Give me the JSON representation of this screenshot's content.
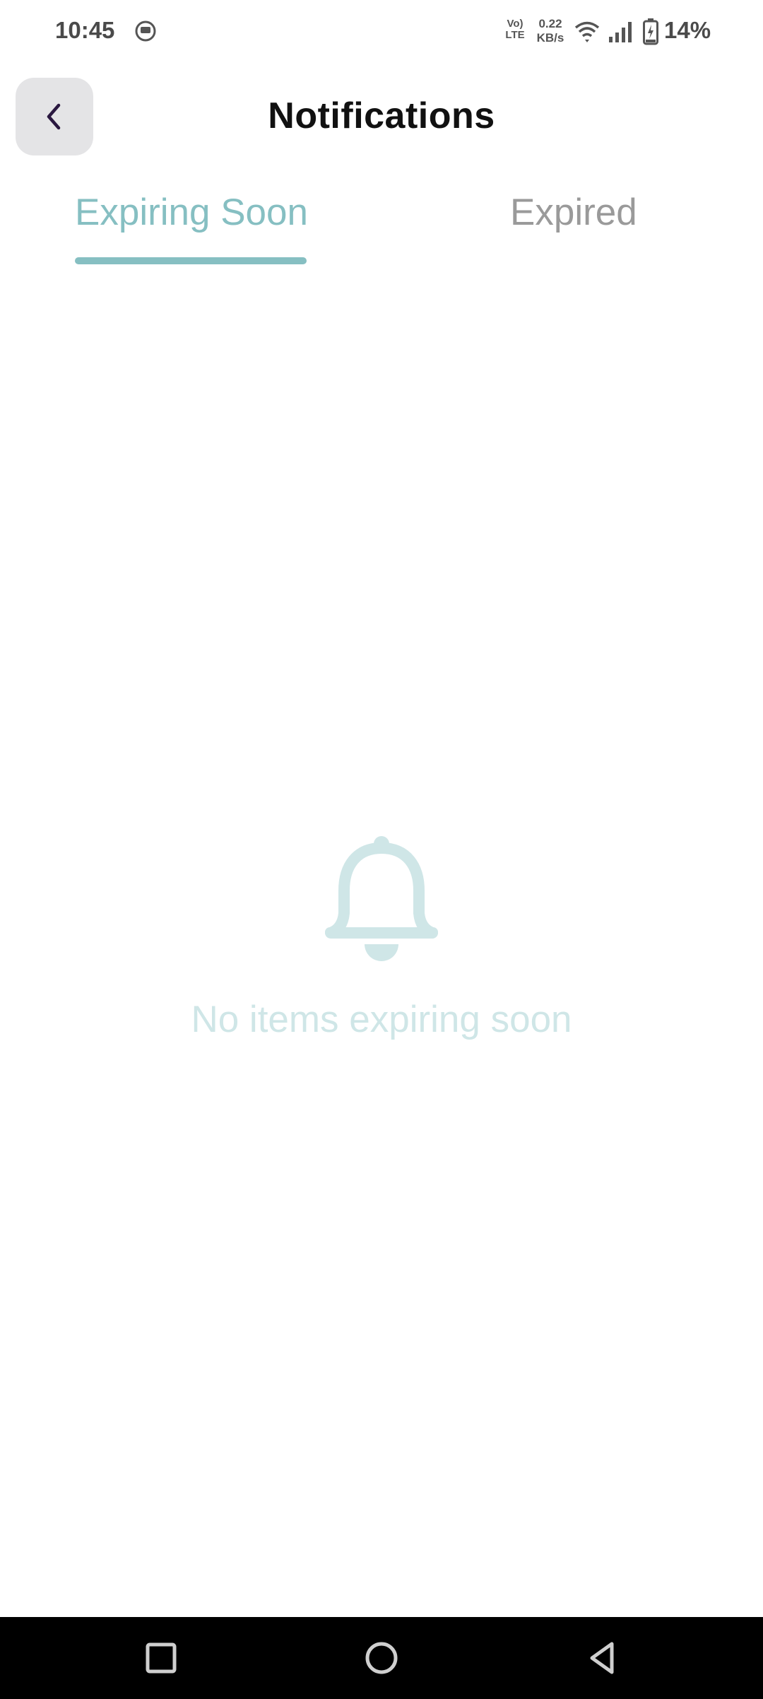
{
  "status_bar": {
    "time": "10:45",
    "volte_line1": "Vo)",
    "volte_line2": "LTE",
    "speed_value": "0.22",
    "speed_unit": "KB/s",
    "battery_percent": "14%"
  },
  "header": {
    "title": "Notifications",
    "back_icon": "chevron-left-icon"
  },
  "tabs": [
    {
      "label": "Expiring Soon",
      "active": true
    },
    {
      "label": "Expired",
      "active": false
    }
  ],
  "empty_state": {
    "icon": "bell-icon",
    "message": "No items expiring soon"
  },
  "colors": {
    "accent": "#86bfc2",
    "inactive_tab": "#9a9a9a",
    "empty_text": "#cfe6e7",
    "back_button_bg": "#e4e4e6",
    "back_chevron": "#2a1840"
  },
  "nav_bar": {
    "buttons": [
      "recents-icon",
      "home-icon",
      "back-icon"
    ]
  }
}
